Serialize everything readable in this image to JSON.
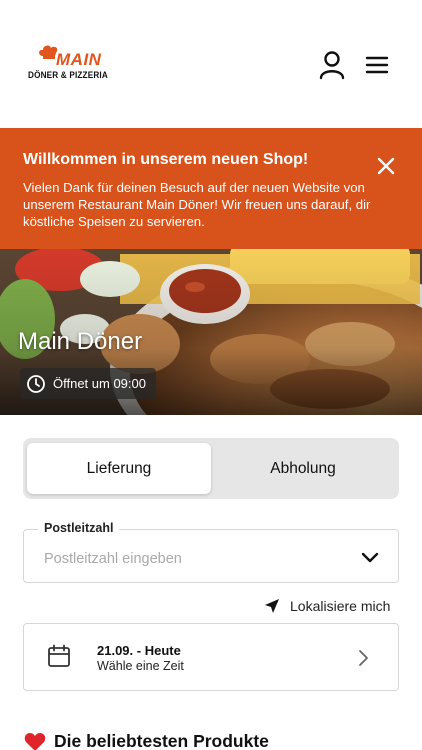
{
  "header": {
    "logo": {
      "main": "MAIN",
      "sub": "DÖNER & PIZZERIA"
    },
    "icons": {
      "account": "user-icon",
      "menu": "hamburger-menu-icon"
    }
  },
  "banner": {
    "title": "Willkommen in unserem neuen Shop!",
    "text": "Vielen Dank für deinen Besuch auf der neuen Website von unserem Restaurant Main Döner! Wir freuen uns darauf, dir köstliche Speisen zu servieren.",
    "background": "#d8521b",
    "close_icon": "close-icon"
  },
  "hero": {
    "title": "Main Döner",
    "hours": "Öffnet um 09:00",
    "hours_icon": "clock-icon"
  },
  "order_mode": {
    "options": [
      "Lieferung",
      "Abholung"
    ],
    "selected": "Lieferung"
  },
  "postcode": {
    "label": "Postleitzahl",
    "placeholder": "Postleitzahl eingeben",
    "value": ""
  },
  "locate": {
    "label": "Lokalisiere mich",
    "icon": "location-arrow-icon"
  },
  "time_selector": {
    "date": "21.09. - Heute",
    "subtitle": "Wähle eine Zeit",
    "icon": "calendar-icon"
  },
  "popular": {
    "title": "Die beliebtesten Produkte",
    "icon": "heart-icon"
  }
}
